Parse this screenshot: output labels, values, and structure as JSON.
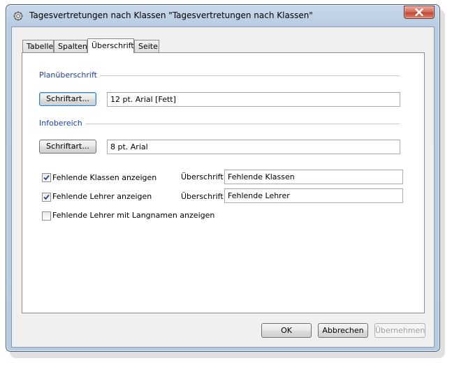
{
  "window": {
    "title": "Tagesvertretungen nach Klassen \"Tagesvertretungen nach Klassen\""
  },
  "tabs": [
    {
      "label": "Tabelle",
      "active": false
    },
    {
      "label": "Spalten",
      "active": false
    },
    {
      "label": "Überschrift",
      "active": true
    },
    {
      "label": "Seite",
      "active": false
    }
  ],
  "plan_heading": {
    "group_label": "Planüberschrift",
    "font_button": "Schriftart...",
    "font_value": "12 pt. Arial  [Fett]"
  },
  "info_area": {
    "group_label": "Infobereich",
    "font_button": "Schriftart...",
    "font_value": "8 pt. Arial"
  },
  "options": {
    "missing_classes": {
      "label": "Fehlende Klassen anzeigen",
      "checked": true,
      "heading_label": "Überschrift",
      "heading_value": "Fehlende Klassen"
    },
    "missing_teachers": {
      "label": "Fehlende Lehrer anzeigen",
      "checked": true,
      "heading_label": "Überschrift",
      "heading_value": "Fehlende Lehrer"
    },
    "missing_teachers_long": {
      "label": "Fehlende Lehrer mit Langnamen anzeigen",
      "checked": false
    }
  },
  "footer": {
    "ok": "OK",
    "cancel": "Abbrechen",
    "apply": "Übernehmen"
  },
  "icons": {
    "app": "gear-icon",
    "close": "close-icon",
    "check": "checkmark-icon"
  },
  "colors": {
    "group_label": "#1e3ea8",
    "close_button": "#c34a36",
    "window_frame": "#b8cde3"
  }
}
